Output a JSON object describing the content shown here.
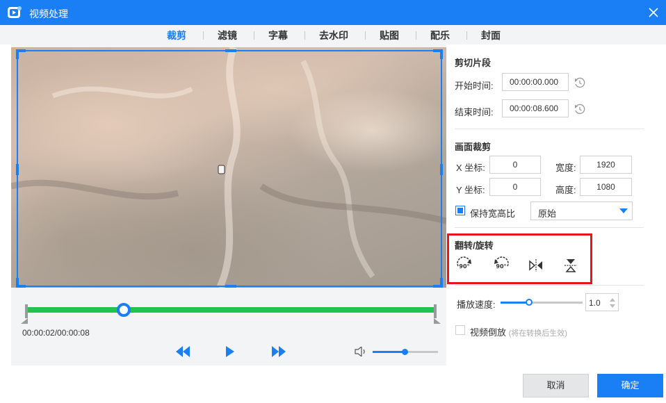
{
  "window": {
    "title": "视频处理",
    "close_icon": "close-icon",
    "accent": "#1a7ef5"
  },
  "tabs": [
    {
      "label": "裁剪",
      "active": true
    },
    {
      "label": "滤镜"
    },
    {
      "label": "字幕"
    },
    {
      "label": "去水印"
    },
    {
      "label": "贴图"
    },
    {
      "label": "配乐"
    },
    {
      "label": "封面"
    }
  ],
  "player": {
    "timecode": "00:00:02/00:00:08",
    "progress_fraction": 0.25,
    "volume_fraction": 0.5,
    "timeline_color": "#21c24d"
  },
  "clip": {
    "title": "剪切片段",
    "start_label": "开始时间:",
    "start_value": "00:00:00.000",
    "end_label": "结束时间:",
    "end_value": "00:00:08.600"
  },
  "crop": {
    "title": "画面裁剪",
    "x_label": "X 坐标:",
    "x_value": "0",
    "y_label": "Y 坐标:",
    "y_value": "0",
    "width_label": "宽度:",
    "width_value": "1920",
    "height_label": "高度:",
    "height_value": "1080",
    "keep_ratio_label": "保持宽高比",
    "keep_ratio_checked": true,
    "ratio_option": "原始"
  },
  "rotate": {
    "title": "翻转/旋转",
    "badge_90": "90°",
    "highlight_color": "#e8141b"
  },
  "speed": {
    "label": "播放速度:",
    "value": "1.0",
    "fraction": 0.34
  },
  "reverse": {
    "label": "视频倒放",
    "hint": "(将在转换后生效)",
    "checked": false
  },
  "footer": {
    "cancel": "取消",
    "ok": "确定"
  }
}
